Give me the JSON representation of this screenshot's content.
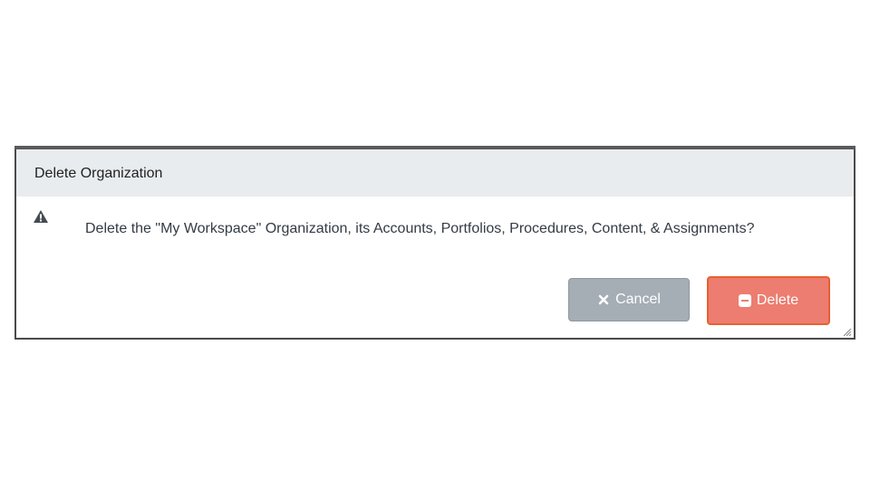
{
  "dialog": {
    "title": "Delete Organization",
    "message": "Delete the \"My Workspace\" Organization, its Accounts, Portfolios, Procedures, Content, & Assignments?",
    "icon": "warning-icon"
  },
  "buttons": {
    "cancel_label": "Cancel",
    "cancel_icon": "close-icon",
    "delete_label": "Delete",
    "delete_icon": "minus-square-icon"
  },
  "colors": {
    "header_bg": "#e9ecef",
    "cancel_bg": "#a5adb5",
    "delete_bg": "#ec7d70",
    "delete_border": "#e8602f"
  }
}
